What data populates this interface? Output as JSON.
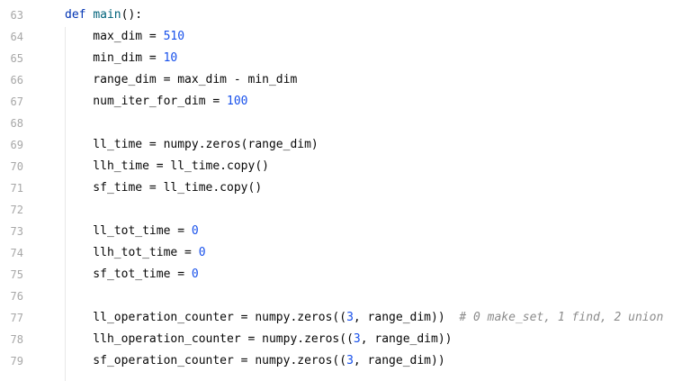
{
  "editor": {
    "language": "python",
    "colors": {
      "background": "#ffffff",
      "line_number": "#a7a7a7",
      "keyword": "#0033b3",
      "function": "#00627a",
      "number": "#1750eb",
      "comment": "#8c8c8c",
      "text": "#080808"
    },
    "line_numbers": [
      "63",
      "64",
      "65",
      "66",
      "67",
      "68",
      "69",
      "70",
      "71",
      "72",
      "73",
      "74",
      "75",
      "76",
      "77",
      "78",
      "79"
    ],
    "lines": {
      "l63": {
        "kw": "def",
        "fn": "main",
        "rest": "():"
      },
      "l64": {
        "a": "    max_dim = ",
        "num": "510"
      },
      "l65": {
        "a": "    min_dim = ",
        "num": "10"
      },
      "l66": {
        "a": "    range_dim = max_dim - min_dim"
      },
      "l67": {
        "a": "    num_iter_for_dim = ",
        "num": "100"
      },
      "l68": {
        "a": ""
      },
      "l69": {
        "a": "    ll_time = numpy.zeros(range_dim)"
      },
      "l70": {
        "a": "    llh_time = ll_time.copy()"
      },
      "l71": {
        "a": "    sf_time = ll_time.copy()"
      },
      "l72": {
        "a": ""
      },
      "l73": {
        "a": "    ll_tot_time = ",
        "num": "0"
      },
      "l74": {
        "a": "    llh_tot_time = ",
        "num": "0"
      },
      "l75": {
        "a": "    sf_tot_time = ",
        "num": "0"
      },
      "l76": {
        "a": ""
      },
      "l77": {
        "a": "    ll_operation_counter = numpy.zeros((",
        "num": "3",
        "b": ", range_dim))  ",
        "cm": "# 0 make_set, 1 find, 2 union"
      },
      "l78": {
        "a": "    llh_operation_counter = numpy.zeros((",
        "num": "3",
        "b": ", range_dim))"
      },
      "l79": {
        "a": "    sf_operation_counter = numpy.zeros((",
        "num": "3",
        "b": ", range_dim))"
      }
    }
  }
}
